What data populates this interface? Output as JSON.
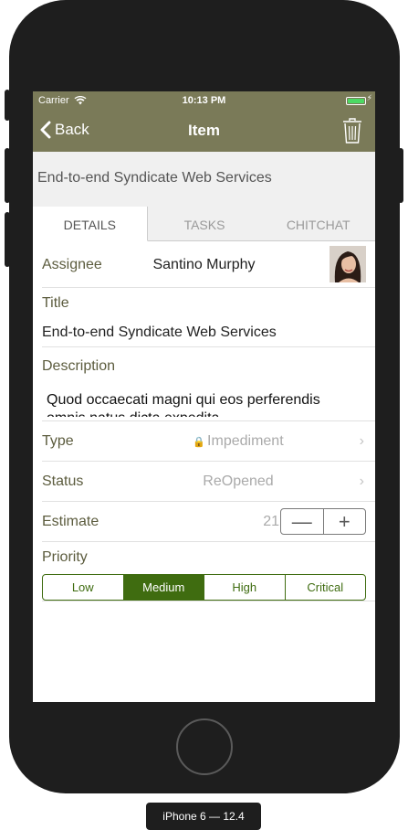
{
  "status_bar": {
    "carrier": "Carrier",
    "time": "10:13 PM"
  },
  "nav": {
    "back_label": "Back",
    "title": "Item"
  },
  "header": {
    "item_name": "End-to-end Syndicate Web Services"
  },
  "tabs": [
    {
      "label": "DETAILS",
      "active": true
    },
    {
      "label": "TASKS",
      "active": false
    },
    {
      "label": "CHITCHAT",
      "active": false
    }
  ],
  "form": {
    "assignee": {
      "label": "Assignee",
      "value": "Santino Murphy"
    },
    "title": {
      "label": "Title",
      "value": "End-to-end Syndicate Web Services"
    },
    "description": {
      "label": "Description",
      "value": "Quod occaecati magni qui eos perferendis omnis natus dicta expedita"
    },
    "type": {
      "label": "Type",
      "value": "Impediment"
    },
    "status": {
      "label": "Status",
      "value": "ReOpened"
    },
    "estimate": {
      "label": "Estimate",
      "value": "21",
      "minus": "—",
      "plus": "+"
    },
    "priority": {
      "label": "Priority",
      "options": [
        "Low",
        "Medium",
        "High",
        "Critical"
      ],
      "selected": "Medium"
    }
  },
  "device_label": "iPhone 6 — 12.4",
  "colors": {
    "nav_bg": "#7a7a58",
    "accent": "#3f6c10",
    "label": "#5c5c3e"
  }
}
